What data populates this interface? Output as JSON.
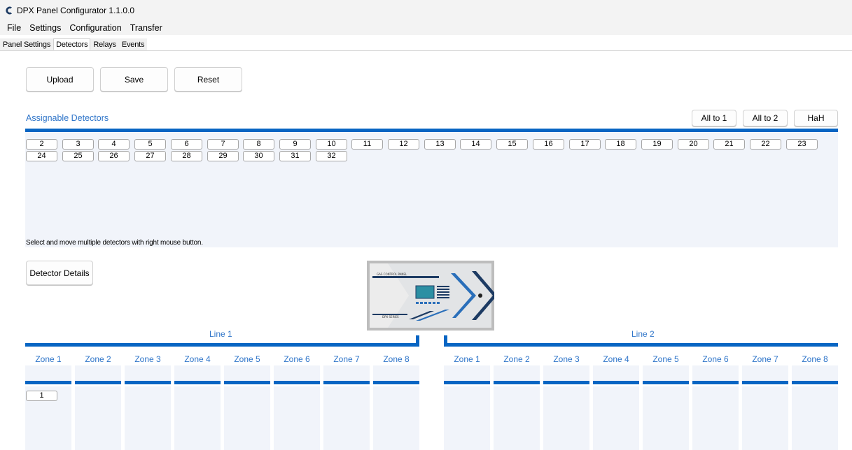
{
  "window": {
    "title": "DPX Panel Configurator 1.1.0.0"
  },
  "menu": [
    "File",
    "Settings",
    "Configuration",
    "Transfer"
  ],
  "tabs": [
    "Panel Settings",
    "Detectors",
    "Relays",
    "Events"
  ],
  "active_tab": "Detectors",
  "toolbar": {
    "upload": "Upload",
    "save": "Save",
    "reset": "Reset"
  },
  "assignable": {
    "title": "Assignable Detectors",
    "all_to_1": "All to 1",
    "all_to_2": "All to 2",
    "hah": "HaH",
    "detectors": [
      "2",
      "3",
      "4",
      "5",
      "6",
      "7",
      "8",
      "9",
      "10",
      "11",
      "12",
      "13",
      "14",
      "15",
      "16",
      "17",
      "18",
      "19",
      "20",
      "21",
      "22",
      "23",
      "24",
      "25",
      "26",
      "27",
      "28",
      "29",
      "30",
      "31",
      "32"
    ],
    "hint": "Select and move multiple detectors with right mouse button."
  },
  "detector_details": "Detector Details",
  "panel_image": {
    "header_text": "GAS CONTROL PANEL",
    "series_text": "DPX SERIES"
  },
  "lines": [
    {
      "label": "Line 1",
      "zones": [
        "Zone 1",
        "Zone 2",
        "Zone 3",
        "Zone 4",
        "Zone 5",
        "Zone 6",
        "Zone 7",
        "Zone 8"
      ],
      "zone1_detectors": [
        "1"
      ]
    },
    {
      "label": "Line 2",
      "zones": [
        "Zone 1",
        "Zone 2",
        "Zone 3",
        "Zone 4",
        "Zone 5",
        "Zone 6",
        "Zone 7",
        "Zone 8"
      ],
      "zone1_detectors": []
    }
  ],
  "colors": {
    "accent": "#0865c3",
    "label_blue": "#2f75c9",
    "panel_bg": "#f1f4fa"
  }
}
